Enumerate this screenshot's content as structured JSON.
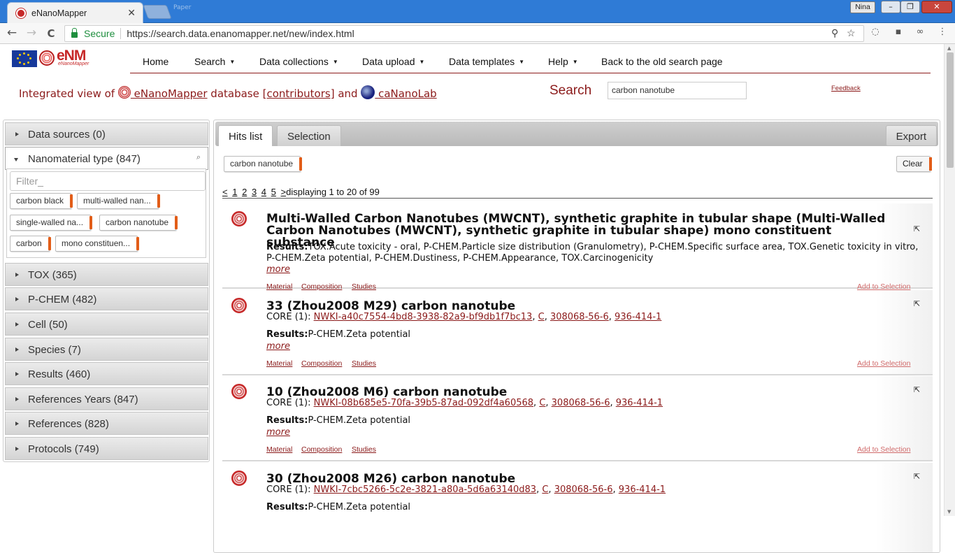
{
  "browser": {
    "tab_title": "eNanoMapper",
    "tab_close": "✕",
    "ghost_tab": "Paper",
    "user": "Nina",
    "min": "–",
    "max": "❐",
    "close": "✕",
    "back": "←",
    "forward": "→",
    "reload": "C",
    "secure_label": "Secure",
    "url": "https://search.data.enanomapper.net/new/index.html",
    "zoom_icon": "⚲",
    "star_icon": "☆",
    "ext_icons": [
      "◌",
      "▪",
      "∞",
      "⋮"
    ]
  },
  "logo": {
    "text": "eNM",
    "sub": "eNanoMapper"
  },
  "nav": {
    "items": [
      {
        "label": "Home",
        "caret": ""
      },
      {
        "label": "Search",
        "caret": "▼"
      },
      {
        "label": "Data collections",
        "caret": "▼"
      },
      {
        "label": "Data upload",
        "caret": "▼"
      },
      {
        "label": "Data templates",
        "caret": "▼"
      },
      {
        "label": "Help",
        "caret": "▼"
      },
      {
        "label": "Back to the old search page",
        "caret": ""
      }
    ]
  },
  "intro": {
    "prefix": "Integrated view of ",
    "enm_link": " eNanoMapper",
    "mid": " database ",
    "contrib_link": "[contributors]",
    "and": " and ",
    "cana_link": " caNanoLab"
  },
  "search": {
    "label": "Search",
    "value": "carbon nanotube"
  },
  "feedback": "Feedback",
  "sidebar": {
    "sections": [
      {
        "label": "Data sources (0)"
      },
      {
        "label": "Nanomaterial type (847)"
      },
      {
        "label": "TOX (365)"
      },
      {
        "label": "P-CHEM (482)"
      },
      {
        "label": "Cell (50)"
      },
      {
        "label": "Species (7)"
      },
      {
        "label": "Results (460)"
      },
      {
        "label": "References Years (847)"
      },
      {
        "label": "References (828)"
      },
      {
        "label": "Protocols (749)"
      }
    ],
    "filter_placeholder": "Filter_",
    "search_icon": "⌕",
    "chips": [
      "carbon black",
      "multi-walled nan...",
      "single-walled na...",
      "carbon nanotube",
      "carbon",
      "mono constituen..."
    ]
  },
  "main": {
    "tabs": [
      "Hits list",
      "Selection"
    ],
    "export": "Export",
    "query_chip": "carbon nanotube",
    "clear": "Clear",
    "pager": {
      "prev": "<",
      "pages": [
        "1",
        "2",
        "3",
        "4",
        "5"
      ],
      "next": ">",
      "status": "displaying 1 to 20 of 99"
    },
    "hits": [
      {
        "title": "Multi-Walled Carbon Nanotubes (MWCNT), synthetic graphite in tubular shape (Multi-Walled Carbon Nanotubes (MWCNT), synthetic graphite in tubular shape) mono constituent substance",
        "core_prefix": "",
        "core_id": "",
        "core_el": "",
        "core_cas": "",
        "core_ec": "",
        "results_label": "Results:",
        "results": "TOX.Acute toxicity - oral, P-CHEM.Particle size distribution (Granulometry), P-CHEM.Specific surface area, TOX.Genetic toxicity in vitro, P-CHEM.Zeta potential, P-CHEM.Dustiness, P-CHEM.Appearance, TOX.Carcinogenicity",
        "more": "more"
      },
      {
        "title": "33 (Zhou2008 M29) carbon nanotube",
        "core_prefix": "CORE (1): ",
        "core_id": "NWKI-a40c7554-4bd8-3938-82a9-bf9db1f7bc13",
        "core_el": "C",
        "core_cas": "308068-56-6",
        "core_ec": "936-414-1",
        "results_label": "Results:",
        "results": "P-CHEM.Zeta potential",
        "more": "more"
      },
      {
        "title": "10 (Zhou2008 M6) carbon nanotube",
        "core_prefix": "CORE (1): ",
        "core_id": "NWKI-08b685e5-70fa-39b5-87ad-092df4a60568",
        "core_el": "C",
        "core_cas": "308068-56-6",
        "core_ec": "936-414-1",
        "results_label": "Results:",
        "results": "P-CHEM.Zeta potential",
        "more": "more"
      },
      {
        "title": "30 (Zhou2008 M26) carbon nanotube",
        "core_prefix": "CORE (1): ",
        "core_id": "NWKI-7cbc5266-5c2e-3821-a80a-5d6a63140d83",
        "core_el": "C",
        "core_cas": "308068-56-6",
        "core_ec": "936-414-1",
        "results_label": "Results:",
        "results": "P-CHEM.Zeta potential",
        "more": ""
      }
    ],
    "hit_links": {
      "material": "Material",
      "composition": "Composition",
      "studies": "Studies",
      "add": "Add to Selection",
      "open_icon": "⇱"
    },
    "sep": ", "
  }
}
